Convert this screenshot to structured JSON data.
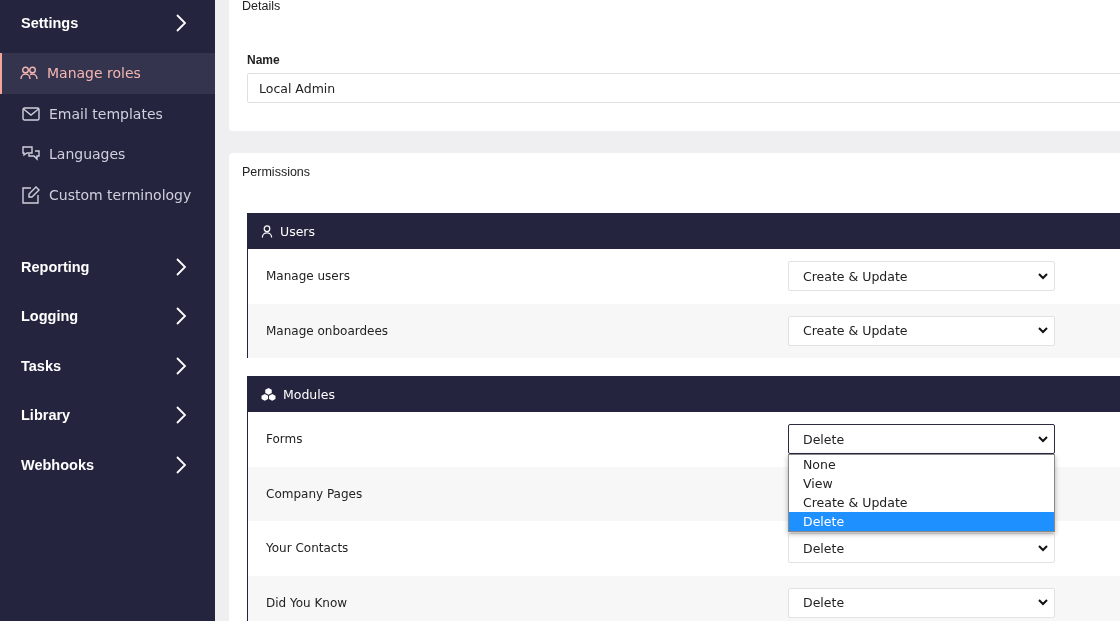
{
  "sidebar": {
    "heading": "Settings",
    "items": [
      {
        "label": "Manage roles",
        "selected": true
      },
      {
        "label": "Email templates",
        "selected": false
      },
      {
        "label": "Languages",
        "selected": false
      },
      {
        "label": "Custom terminology",
        "selected": false
      }
    ],
    "sections": [
      {
        "label": "Reporting"
      },
      {
        "label": "Logging"
      },
      {
        "label": "Tasks"
      },
      {
        "label": "Library"
      },
      {
        "label": "Webhooks"
      }
    ]
  },
  "details": {
    "title": "Details",
    "name_label": "Name",
    "name_value": "Local Admin"
  },
  "permissions": {
    "title": "Permissions",
    "groups": [
      {
        "title": "Users",
        "rows": [
          {
            "label": "Manage users",
            "value": "Create & Update",
            "open": false
          },
          {
            "label": "Manage onboardees",
            "value": "Create & Update",
            "open": false
          }
        ]
      },
      {
        "title": "Modules",
        "rows": [
          {
            "label": "Forms",
            "value": "Delete",
            "open": true,
            "options": [
              {
                "label": "None",
                "selected": false
              },
              {
                "label": "View",
                "selected": false
              },
              {
                "label": "Create & Update",
                "selected": false
              },
              {
                "label": "Delete",
                "selected": true
              }
            ]
          },
          {
            "label": "Company Pages"
          },
          {
            "label": "Your Contacts",
            "value": "Delete",
            "open": false
          },
          {
            "label": "Did You Know",
            "value": "Delete",
            "open": false
          }
        ]
      }
    ]
  }
}
